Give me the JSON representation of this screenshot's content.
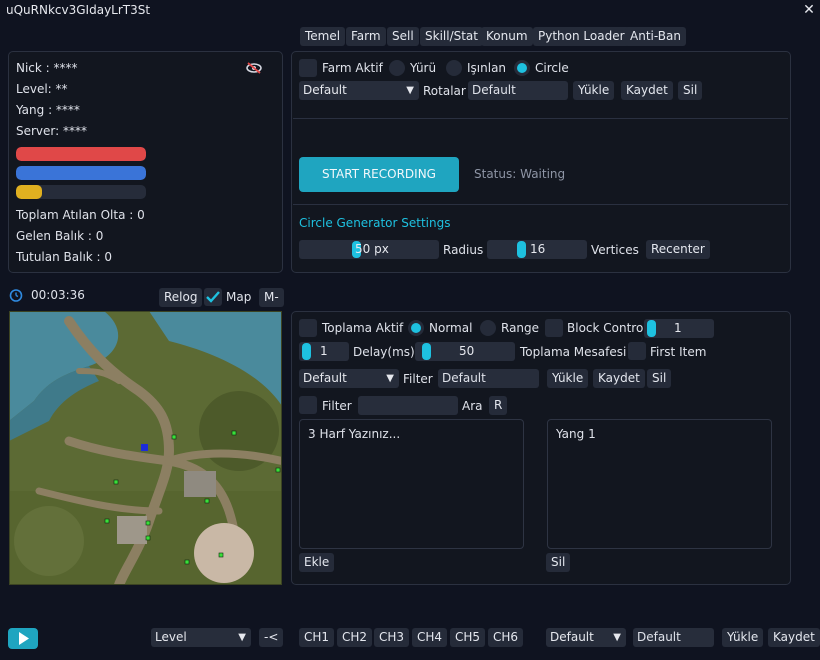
{
  "window": {
    "title": "uQuRNkcv3GIdayLrT3St"
  },
  "tabs": [
    "Temel",
    "Farm",
    "Sell",
    "Skill/Stat",
    "Konum",
    "Python Loader",
    "Anti-Ban"
  ],
  "player": {
    "nick": "Nick : ****",
    "level": "Level: **",
    "yang": "Yang : ****",
    "server": "Server: ****",
    "hp_fraction": 1.0,
    "mp_fraction": 1.0,
    "exp_fraction": 0.2,
    "colors": {
      "hp": "#e04848",
      "mp": "#3a74d8",
      "exp": "#e0b020"
    },
    "stat_olta": "Toplam Atılan Olta : 0",
    "stat_gelen": "Gelen Balık : 0",
    "stat_tutulan": "Tutulan Balık : 0"
  },
  "timer": {
    "value": "00:03:36",
    "relog": "Relog",
    "map_label": "Map",
    "m_button": "M-"
  },
  "farm": {
    "farm_aktif": "Farm Aktif",
    "yuru": "Yürü",
    "isinlan": "Işınlan",
    "circle": "Circle",
    "route_select": "Default",
    "rotalar_label": "Rotalar",
    "route_name": "Default",
    "yukle": "Yükle",
    "kaydet": "Kaydet",
    "sil": "Sil",
    "start_recording": "START RECORDING",
    "status": "Status: Waiting",
    "circle_settings_title": "Circle Generator Settings",
    "radius_value": "50 px",
    "radius_label": "Radius",
    "vertices_value": "16",
    "vertices_label": "Vertices",
    "recenter": "Recenter"
  },
  "pickup": {
    "toplama_aktif": "Toplama Aktif",
    "normal": "Normal",
    "range": "Range",
    "block_control": "Block Control",
    "block_value": "1",
    "delay_value": "1",
    "delay_label": "Delay(ms)",
    "distance_value": "50",
    "distance_label": "Toplama Mesafesi",
    "first_item": "First Item",
    "filter_select": "Default",
    "filter_label": "Filter",
    "filter_name": "Default",
    "yukle": "Yükle",
    "kaydet": "Kaydet",
    "sil": "Sil",
    "filter2_label": "Filter",
    "ara_label": "Ara",
    "r_button": "R",
    "input_placeholder": "3 Harf Yazınız...",
    "list_items": [
      "Yang 1"
    ],
    "ekle": "Ekle",
    "sil2": "Sil"
  },
  "bottom": {
    "level_select": "Level",
    "back_button": "-<",
    "channels": [
      "CH1",
      "CH2",
      "CH3",
      "CH4",
      "CH5",
      "CH6"
    ],
    "preset_select": "Default",
    "preset_name": "Default",
    "yukle": "Yükle",
    "kaydet": "Kaydet"
  },
  "colors": {
    "accent": "#1ec1e0",
    "panel_bg": "#12161f",
    "window_bg": "#0f1320"
  }
}
